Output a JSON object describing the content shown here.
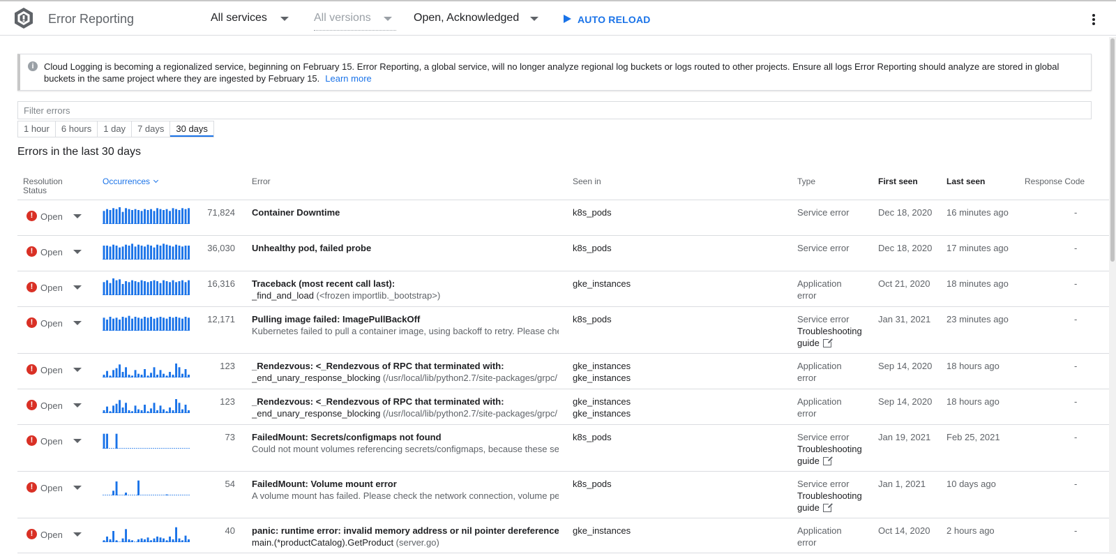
{
  "header": {
    "title": "Error Reporting",
    "services": "All services",
    "versions": "All versions",
    "status_filter": "Open, Acknowledged",
    "auto_reload": "AUTO RELOAD"
  },
  "banner": {
    "text": "Cloud Logging is becoming a regionalized service, beginning on February 15. Error Reporting, a global service, will no longer analyze regional log buckets or logs routed to other projects. Ensure all logs Error Reporting should analyze are stored in global buckets in the same project where they are ingested by February 15.",
    "link": "Learn more"
  },
  "filter": {
    "placeholder": "Filter errors"
  },
  "ranges": [
    "1 hour",
    "6 hours",
    "1 day",
    "7 days",
    "30 days"
  ],
  "section_title": "Errors in the last 30 days",
  "columns": {
    "resolution_line1": "Resolution",
    "resolution_line2": "Status",
    "occurrences": "Occurrences",
    "error": "Error",
    "seen_in": "Seen in",
    "type": "Type",
    "first_seen": "First seen",
    "last_seen": "Last seen",
    "response_code": "Response Code"
  },
  "rows": [
    {
      "status": "Open",
      "count": "71,824",
      "title": "Container Downtime",
      "sub": "",
      "sub_path": "",
      "seen": "k8s_pods",
      "seen2": "",
      "type1": "Service error",
      "type2": "",
      "guide": "",
      "first": "Dec 18, 2020",
      "last": "16 minutes ago",
      "resp": "-",
      "spark": [
        14,
        16,
        15,
        17,
        16,
        18,
        13,
        17,
        16,
        15,
        16,
        15,
        14,
        16,
        15,
        16,
        14,
        17,
        16,
        15,
        16,
        14,
        17,
        16,
        15,
        17,
        16,
        17
      ]
    },
    {
      "status": "Open",
      "count": "36,030",
      "title": "Unhealthy pod, failed probe",
      "sub": "",
      "sub_path": "",
      "seen": "k8s_pods",
      "seen2": "",
      "type1": "Service error",
      "type2": "",
      "guide": "",
      "first": "Dec 18, 2020",
      "last": "17 minutes ago",
      "resp": "-",
      "spark": [
        15,
        15,
        14,
        16,
        15,
        13,
        14,
        16,
        15,
        17,
        14,
        16,
        15,
        14,
        16,
        15,
        13,
        16,
        15,
        17,
        16,
        15,
        14,
        16,
        15,
        14,
        15,
        15
      ]
    },
    {
      "status": "Open",
      "count": "16,316",
      "title": "Traceback (most recent call last):",
      "sub": "_find_and_load",
      "sub_path": " (<frozen importlib._bootstrap>)",
      "seen": "gke_instances",
      "seen2": "",
      "type1": "Application",
      "type2": "error",
      "guide": "",
      "first": "Oct 21, 2020",
      "last": "18 minutes ago",
      "resp": "-",
      "spark": [
        14,
        16,
        13,
        18,
        16,
        17,
        12,
        15,
        14,
        16,
        15,
        14,
        16,
        15,
        14,
        15,
        16,
        15,
        13,
        16,
        15,
        14,
        16,
        14,
        15,
        16,
        14,
        16
      ]
    },
    {
      "status": "Open",
      "count": "12,171",
      "title": "Pulling image failed: ImagePullBackOff",
      "sub": "Kubernetes failed to pull a container image, using backoff to retry. Please che",
      "sub_path": "",
      "seen": "k8s_pods",
      "seen2": "",
      "type1": "Service error",
      "type2": "Troubleshooting",
      "guide": "guide",
      "first": "Jan 31, 2021",
      "last": "23 minutes ago",
      "resp": "-",
      "spark": [
        14,
        12,
        15,
        13,
        14,
        12,
        15,
        14,
        16,
        13,
        15,
        14,
        13,
        15,
        14,
        15,
        13,
        14,
        15,
        14,
        13,
        15,
        14,
        15,
        14,
        13,
        15,
        14
      ]
    },
    {
      "status": "Open",
      "count": "123",
      "title": "_Rendezvous: <_Rendezvous of RPC that terminated with:",
      "sub": "_end_unary_response_blocking",
      "sub_path": " (/usr/local/lib/python2.7/site-packages/grpc/",
      "seen": "gke_instances",
      "seen2": "gke_instances",
      "type1": "Application",
      "type2": "error",
      "guide": "",
      "first": "Sep 14, 2020",
      "last": "18 hours ago",
      "resp": "-",
      "spark": [
        3,
        7,
        2,
        8,
        10,
        14,
        6,
        11,
        3,
        2,
        8,
        4,
        3,
        9,
        2,
        5,
        11,
        3,
        8,
        4,
        2,
        6,
        3,
        15,
        11,
        4,
        9,
        3
      ]
    },
    {
      "status": "Open",
      "count": "123",
      "title": "_Rendezvous: <_Rendezvous of RPC that terminated with:",
      "sub": "_end_unary_response_blocking",
      "sub_path": " (/usr/local/lib/python2.7/site-packages/grpc/",
      "seen": "gke_instances",
      "seen2": "gke_instances",
      "type1": "Application",
      "type2": "error",
      "guide": "",
      "first": "Sep 14, 2020",
      "last": "18 hours ago",
      "resp": "-",
      "spark": [
        3,
        7,
        2,
        8,
        10,
        14,
        6,
        11,
        3,
        2,
        8,
        4,
        3,
        9,
        2,
        5,
        11,
        3,
        8,
        4,
        2,
        6,
        3,
        15,
        11,
        4,
        9,
        3
      ]
    },
    {
      "status": "Open",
      "count": "73",
      "title": "FailedMount: Secrets/configmaps not found",
      "sub": "Could not mount volumes referencing secrets/configmaps, because these sec",
      "sub_path": "",
      "seen": "k8s_pods",
      "seen2": "",
      "type1": "Service error",
      "type2": "Troubleshooting",
      "guide": "guide",
      "first": "Jan 19, 2021",
      "last": "Feb 25, 2021",
      "resp": "-",
      "spark": [
        16,
        16,
        0,
        0,
        16,
        0,
        0,
        0,
        0,
        0,
        0,
        0,
        0,
        0,
        0,
        0,
        0,
        0,
        0,
        0,
        0,
        0,
        0,
        0,
        0,
        0,
        0,
        0
      ]
    },
    {
      "status": "Open",
      "count": "54",
      "title": "FailedMount: Volume mount error",
      "sub": "A volume mount has failed. Please check the network connection, volume per",
      "sub_path": "",
      "seen": "k8s_pods",
      "seen2": "",
      "type1": "Service error",
      "type2": "Troubleshooting",
      "guide": "guide",
      "first": "Jan 1, 2021",
      "last": "10 days ago",
      "resp": "-",
      "spark": [
        0,
        0,
        0,
        5,
        15,
        0,
        0,
        3,
        0,
        0,
        0,
        16,
        0,
        0,
        0,
        0,
        0,
        0,
        0,
        0,
        1,
        0,
        0,
        0,
        0,
        0,
        0,
        0
      ]
    },
    {
      "status": "Open",
      "count": "40",
      "title": "panic: runtime error: invalid memory address or nil pointer dereference",
      "sub": "main.(*productCatalog).",
      "sub_path": "",
      "sub_bold": "GetProduct",
      "sub_tail": " (server.go)",
      "seen": "gke_instances",
      "seen2": "",
      "type1": "Application",
      "type2": "error",
      "guide": "",
      "first": "Oct 14, 2020",
      "last": "2 hours ago",
      "resp": "-",
      "spark": [
        2,
        6,
        3,
        12,
        2,
        0,
        4,
        14,
        3,
        2,
        0,
        3,
        4,
        3,
        5,
        2,
        4,
        6,
        5,
        4,
        2,
        6,
        3,
        16,
        4,
        2,
        7,
        3
      ]
    }
  ],
  "colors": {
    "accent": "#1a73e8",
    "error": "#d93025",
    "spark": "#1a73e8"
  }
}
